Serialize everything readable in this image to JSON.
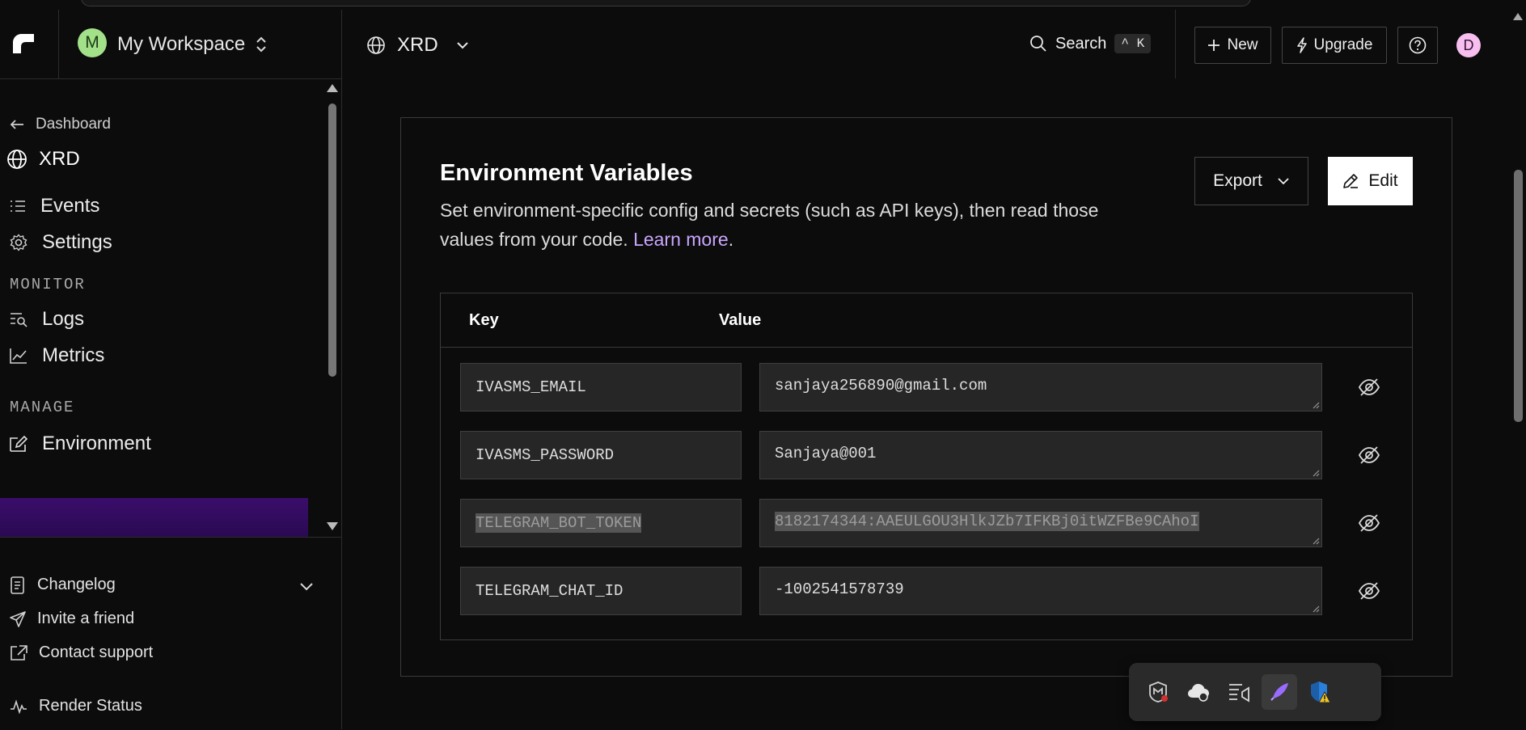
{
  "workspace": {
    "initial": "M",
    "name": "My Workspace"
  },
  "sidebar": {
    "back_label": "Dashboard",
    "project_name": "XRD",
    "items": [
      {
        "label": "Events",
        "icon": "list-icon"
      },
      {
        "label": "Settings",
        "icon": "gear-icon"
      }
    ],
    "monitor_label": "MONITOR",
    "monitor_items": [
      {
        "label": "Logs",
        "icon": "logs-search-icon"
      },
      {
        "label": "Metrics",
        "icon": "chart-line-icon"
      }
    ],
    "manage_label": "MANAGE",
    "manage_items": [
      {
        "label": "Environment",
        "icon": "environment-icon",
        "active": true
      }
    ],
    "bottom": {
      "changelog": "Changelog",
      "invite": "Invite a friend",
      "support": "Contact support",
      "render_status": "Render Status"
    }
  },
  "header": {
    "project": "XRD",
    "search_label": "Search",
    "search_shortcut": "^ K",
    "new_label": "New",
    "upgrade_label": "Upgrade",
    "user_initial": "D"
  },
  "env": {
    "title": "Environment Variables",
    "description": "Set environment-specific config and secrets (such as API keys), then read those values from your code.",
    "learn_more": "Learn more",
    "export_label": "Export",
    "edit_label": "Edit",
    "col_key": "Key",
    "col_value": "Value",
    "rows": [
      {
        "key": "IVASMS_EMAIL",
        "value": "sanjaya256890@gmail.com"
      },
      {
        "key": "IVASMS_PASSWORD",
        "value": "Sanjaya@001"
      },
      {
        "key": "TELEGRAM_BOT_TOKEN",
        "value": "8182174344:AAEULGOU3HlkJZb7IFKBj0itWZFBe9CAhoI",
        "selected": true
      },
      {
        "key": "TELEGRAM_CHAT_ID",
        "value": "-1002541578739"
      }
    ]
  },
  "colors": {
    "accent_link": "#c9a6ff",
    "active_nav": "#3a0d6b",
    "workspace_avatar": "#a3e08a",
    "user_avatar": "#f6bff0"
  },
  "tray_icons": [
    "mcafee-icon",
    "cloud-sync-icon",
    "task-view-icon",
    "feather-icon",
    "defender-warning-icon"
  ]
}
